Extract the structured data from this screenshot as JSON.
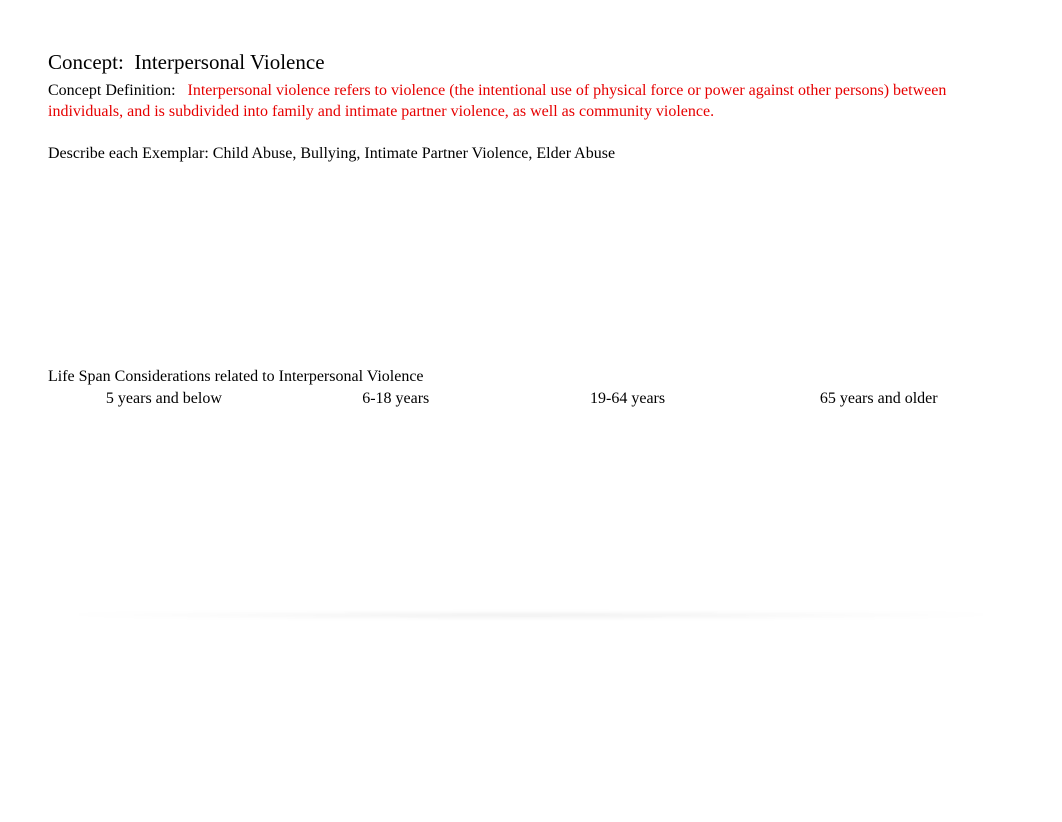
{
  "concept": {
    "label": "Concept:",
    "title": "Interpersonal Violence"
  },
  "definition": {
    "label": "Concept Definition:",
    "text": "Interpersonal violence refers to violence (the intentional use of physical force or power against other persons) between individuals, and is subdivided into family and intimate partner violence, as well as community violence."
  },
  "exemplar": {
    "text": "Describe each Exemplar: Child Abuse, Bullying, Intimate Partner Violence, Elder Abuse"
  },
  "lifespan": {
    "heading": "Life Span Considerations related to Interpersonal Violence",
    "columns": [
      "5 years and below",
      "6-18 years",
      "19-64 years",
      "65 years and older"
    ]
  },
  "colors": {
    "definition_text": "#e60000"
  }
}
